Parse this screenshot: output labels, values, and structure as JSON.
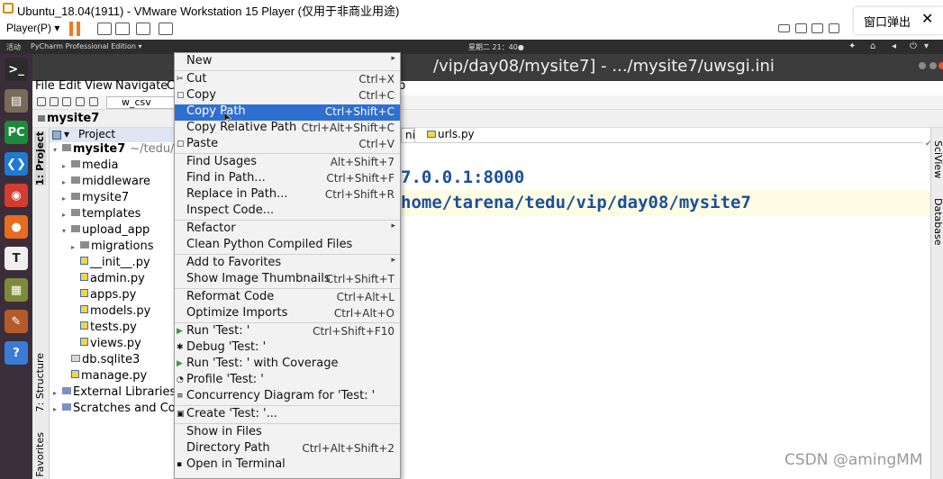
{
  "vmware": {
    "title": "Ubuntu_18.04(1911) - VMware Workstation 15 Player (仅用于非商业用途)",
    "player_menu": "Player(P) ▾",
    "popup_label": "窗口弹出",
    "popup_close": "✕",
    "minimize": "─",
    "maximize": "☐"
  },
  "ubuntu_panel": {
    "activities": "活动",
    "app_name": "PyCharm Professional Edition ▾",
    "clock": "星期二 21：40●"
  },
  "pycharm": {
    "window_title": "/vip/day08/mysite7] - .../mysite7/uwsgi.ini",
    "menus": [
      "File",
      "Edit",
      "View",
      "Navigate",
      "C",
      "p"
    ],
    "run_config": "w_csv",
    "breadcrumb": "mysite7",
    "project_tab_label": "Project",
    "left_tabs": [
      "1: Project",
      "7: Structure",
      "Favorites"
    ],
    "right_tabs": [
      "SciView",
      "Database"
    ],
    "tree": [
      {
        "label": "mysite7",
        "extra": "~/tedu/vip",
        "bold": true,
        "type": "folder",
        "depth": 0,
        "arrow": "▾"
      },
      {
        "label": "media",
        "type": "folder",
        "depth": 1,
        "arrow": "▸"
      },
      {
        "label": "middleware",
        "type": "folder",
        "depth": 1,
        "arrow": "▸"
      },
      {
        "label": "mysite7",
        "type": "folder",
        "depth": 1,
        "arrow": "▸"
      },
      {
        "label": "templates",
        "type": "folder",
        "depth": 1,
        "arrow": "▸"
      },
      {
        "label": "upload_app",
        "type": "folder",
        "depth": 1,
        "arrow": "▾"
      },
      {
        "label": "migrations",
        "type": "folder",
        "depth": 2,
        "arrow": "▸"
      },
      {
        "label": "__init__.py",
        "type": "py",
        "depth": 2,
        "arrow": ""
      },
      {
        "label": "admin.py",
        "type": "py",
        "depth": 2,
        "arrow": ""
      },
      {
        "label": "apps.py",
        "type": "py",
        "depth": 2,
        "arrow": ""
      },
      {
        "label": "models.py",
        "type": "py",
        "depth": 2,
        "arrow": ""
      },
      {
        "label": "tests.py",
        "type": "py",
        "depth": 2,
        "arrow": ""
      },
      {
        "label": "views.py",
        "type": "py",
        "depth": 2,
        "arrow": ""
      },
      {
        "label": "db.sqlite3",
        "type": "db",
        "depth": 1,
        "arrow": ""
      },
      {
        "label": "manage.py",
        "type": "py",
        "depth": 1,
        "arrow": ""
      },
      {
        "label": "External Libraries",
        "type": "lib",
        "depth": 0,
        "arrow": "▸"
      },
      {
        "label": "Scratches and Conso",
        "type": "lib",
        "depth": 0,
        "arrow": "▸"
      }
    ],
    "editor_tabs": [
      "ni",
      "urls.py"
    ],
    "code_lines": [
      "7.0.0.1:8000",
      "home/tarena/tedu/vip/day08/mysite7"
    ]
  },
  "context_menu": [
    {
      "label": "New",
      "shortcut": "",
      "submenu": true,
      "icon": ""
    },
    {
      "sep": true
    },
    {
      "label": "Cut",
      "shortcut": "Ctrl+X",
      "icon": "✂"
    },
    {
      "label": "Copy",
      "shortcut": "Ctrl+C",
      "icon": "▢"
    },
    {
      "label": "Copy Path",
      "shortcut": "Ctrl+Shift+C",
      "highlighted": true,
      "icon": ""
    },
    {
      "label": "Copy Relative Path",
      "shortcut": "Ctrl+Alt+Shift+C",
      "icon": ""
    },
    {
      "label": "Paste",
      "shortcut": "Ctrl+V",
      "icon": "▢"
    },
    {
      "sep": true
    },
    {
      "label": "Find Usages",
      "shortcut": "Alt+Shift+7",
      "icon": ""
    },
    {
      "label": "Find in Path...",
      "shortcut": "Ctrl+Shift+F",
      "icon": ""
    },
    {
      "label": "Replace in Path...",
      "shortcut": "Ctrl+Shift+R",
      "icon": ""
    },
    {
      "label": "Inspect Code...",
      "shortcut": "",
      "icon": ""
    },
    {
      "sep": true
    },
    {
      "label": "Refactor",
      "shortcut": "",
      "submenu": true,
      "icon": ""
    },
    {
      "label": "Clean Python Compiled Files",
      "shortcut": "",
      "icon": ""
    },
    {
      "sep": true
    },
    {
      "label": "Add to Favorites",
      "shortcut": "",
      "submenu": true,
      "icon": ""
    },
    {
      "label": "Show Image Thumbnails",
      "shortcut": "Ctrl+Shift+T",
      "icon": ""
    },
    {
      "sep": true
    },
    {
      "label": "Reformat Code",
      "shortcut": "Ctrl+Alt+L",
      "icon": ""
    },
    {
      "label": "Optimize Imports",
      "shortcut": "Ctrl+Alt+O",
      "icon": ""
    },
    {
      "sep": true
    },
    {
      "label": "Run 'Test: '",
      "shortcut": "Ctrl+Shift+F10",
      "icon": "▶"
    },
    {
      "label": "Debug 'Test: '",
      "shortcut": "",
      "icon": "✱"
    },
    {
      "label": "Run 'Test: ' with Coverage",
      "shortcut": "",
      "icon": "▶"
    },
    {
      "label": "Profile 'Test: '",
      "shortcut": "",
      "icon": "◔"
    },
    {
      "label": "Concurrency Diagram for 'Test: '",
      "shortcut": "",
      "icon": "≡"
    },
    {
      "sep": true
    },
    {
      "label": "Create 'Test: '...",
      "shortcut": "",
      "icon": "▣"
    },
    {
      "sep": true
    },
    {
      "label": "Show in Files",
      "shortcut": "",
      "icon": ""
    },
    {
      "label": "Directory Path",
      "shortcut": "Ctrl+Alt+Shift+2",
      "icon": ""
    },
    {
      "label": "Open in Terminal",
      "shortcut": "",
      "icon": "▪"
    }
  ],
  "dock_items": [
    {
      "name": "terminal-icon",
      "glyph": ">_",
      "color": "#2b2b2b"
    },
    {
      "name": "files-icon",
      "glyph": "▤",
      "color": "#7a6a58"
    },
    {
      "name": "pycharm-icon",
      "glyph": "PC",
      "color": "#1b8a3d"
    },
    {
      "name": "vscode-icon",
      "glyph": "❮❯",
      "color": "#1f7ad1"
    },
    {
      "name": "chrome-icon",
      "glyph": "◉",
      "color": "#d63b2f"
    },
    {
      "name": "firefox-icon",
      "glyph": "●",
      "color": "#e76c1e"
    },
    {
      "name": "typora-icon",
      "glyph": "T",
      "color": "#efefef"
    },
    {
      "name": "books-icon",
      "glyph": "▦",
      "color": "#7d8a3a"
    },
    {
      "name": "tools-icon",
      "glyph": "✎",
      "color": "#b45a2a"
    },
    {
      "name": "help-icon",
      "glyph": "?",
      "color": "#3a7bd5"
    }
  ],
  "watermark": "CSDN @amingMM"
}
